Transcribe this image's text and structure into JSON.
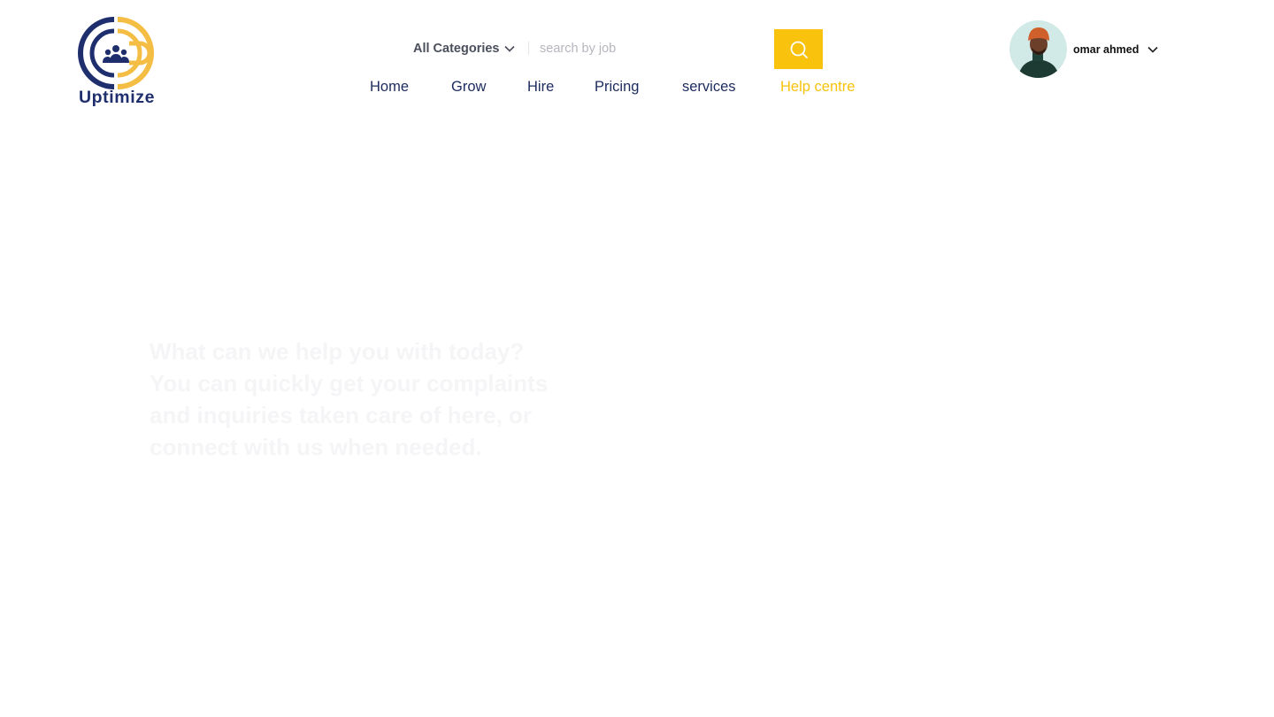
{
  "brand": {
    "name": "Uptimize"
  },
  "search": {
    "category_label": "All Categories",
    "placeholder": "search by job"
  },
  "nav": {
    "items": [
      {
        "label": "Home"
      },
      {
        "label": "Grow"
      },
      {
        "label": "Hire"
      },
      {
        "label": "Pricing"
      },
      {
        "label": "services"
      },
      {
        "label": "Help centre"
      }
    ],
    "active_item": "Help centre"
  },
  "user": {
    "name": "omar ahmed"
  },
  "hero": {
    "text": "What can we help you with today? You can quickly get your complaints and inquiries taken care of here, or connect with us when needed."
  },
  "colors": {
    "accent": "#f9c20c",
    "nav_text": "#1c2b5e",
    "logo_blue": "#1f2f6e",
    "hero_text": "#f5f5f7"
  },
  "icons": {
    "search_button": "search-icon",
    "categories": "chevron-down-icon",
    "user_menu": "chevron-down-icon"
  }
}
